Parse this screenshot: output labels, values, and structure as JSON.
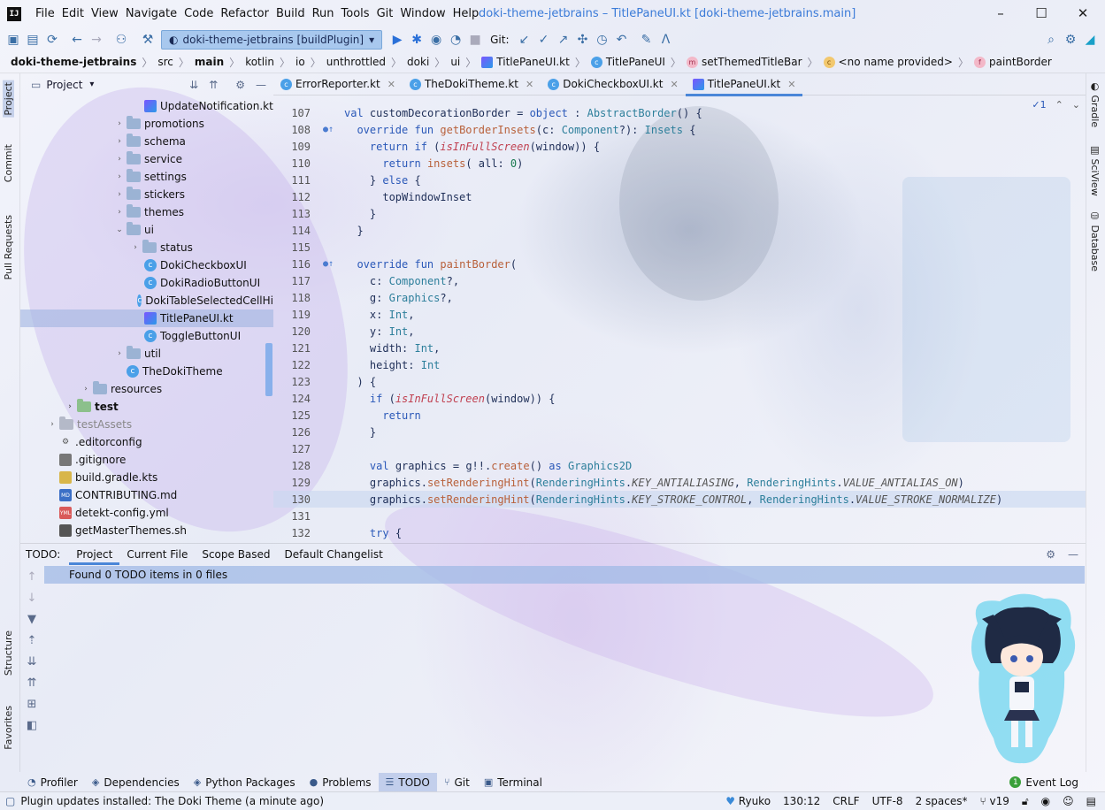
{
  "app": {
    "logo_text": "IJ",
    "window_title": "doki-theme-jetbrains – TitlePaneUI.kt [doki-theme-jetbrains.main]",
    "menu": [
      "File",
      "Edit",
      "View",
      "Navigate",
      "Code",
      "Refactor",
      "Build",
      "Run",
      "Tools",
      "Git",
      "Window",
      "Help"
    ],
    "controls": {
      "minimize": "–",
      "maximize": "☐",
      "close": "✕"
    }
  },
  "toolbar": {
    "run_config": "doki-theme-jetbrains [buildPlugin]",
    "git_label": "Git:"
  },
  "breadcrumb": [
    {
      "text": "doki-theme-jetbrains",
      "bold": true,
      "icon": ""
    },
    {
      "text": "src",
      "bold": false,
      "icon": ""
    },
    {
      "text": "main",
      "bold": true,
      "icon": ""
    },
    {
      "text": "kotlin",
      "bold": false,
      "icon": ""
    },
    {
      "text": "io",
      "bold": false,
      "icon": ""
    },
    {
      "text": "unthrottled",
      "bold": false,
      "icon": ""
    },
    {
      "text": "doki",
      "bold": false,
      "icon": ""
    },
    {
      "text": "ui",
      "bold": false,
      "icon": ""
    },
    {
      "text": "TitlePaneUI.kt",
      "bold": false,
      "icon": "kotlin-file"
    },
    {
      "text": "TitlePaneUI",
      "bold": false,
      "icon": "class"
    },
    {
      "text": "setThemedTitleBar",
      "bold": false,
      "icon": "method"
    },
    {
      "text": "<no name provided>",
      "bold": false,
      "icon": "anonymous"
    },
    {
      "text": "paintBorder",
      "bold": false,
      "icon": "function"
    }
  ],
  "left_strip": [
    "Project",
    "Commit",
    "Pull Requests",
    "Structure",
    "Favorites"
  ],
  "right_strip": [
    "Gradle",
    "SciView",
    "Database"
  ],
  "project_panel": {
    "title": "Project",
    "tree": [
      {
        "label": "UpdateNotification.kt",
        "type": "kt",
        "indent": 6,
        "arrow": ""
      },
      {
        "label": "promotions",
        "type": "folder",
        "indent": 5,
        "arrow": "›"
      },
      {
        "label": "schema",
        "type": "folder",
        "indent": 5,
        "arrow": "›"
      },
      {
        "label": "service",
        "type": "folder",
        "indent": 5,
        "arrow": "›"
      },
      {
        "label": "settings",
        "type": "folder",
        "indent": 5,
        "arrow": "›"
      },
      {
        "label": "stickers",
        "type": "folder",
        "indent": 5,
        "arrow": "›"
      },
      {
        "label": "themes",
        "type": "folder",
        "indent": 5,
        "arrow": "›"
      },
      {
        "label": "ui",
        "type": "folder",
        "indent": 5,
        "arrow": "⌄"
      },
      {
        "label": "status",
        "type": "folder",
        "indent": 6,
        "arrow": "›"
      },
      {
        "label": "DokiCheckboxUI",
        "type": "class",
        "indent": 7,
        "arrow": ""
      },
      {
        "label": "DokiRadioButtonUI",
        "type": "class",
        "indent": 7,
        "arrow": ""
      },
      {
        "label": "DokiTableSelectedCellHi",
        "type": "class",
        "indent": 7,
        "arrow": ""
      },
      {
        "label": "TitlePaneUI.kt",
        "type": "kt",
        "indent": 7,
        "arrow": "",
        "selected": true
      },
      {
        "label": "ToggleButtonUI",
        "type": "class",
        "indent": 7,
        "arrow": ""
      },
      {
        "label": "util",
        "type": "folder",
        "indent": 5,
        "arrow": "›"
      },
      {
        "label": "TheDokiTheme",
        "type": "class",
        "indent": 6,
        "arrow": ""
      },
      {
        "label": "resources",
        "type": "folder",
        "indent": 3,
        "arrow": "›"
      },
      {
        "label": "test",
        "type": "folder-test",
        "indent": 2,
        "arrow": "›",
        "bold": true
      },
      {
        "label": "testAssets",
        "type": "folder-assets",
        "indent": 1,
        "arrow": "›",
        "muted": true
      },
      {
        "label": ".editorconfig",
        "type": "cfg",
        "indent": 1,
        "arrow": ""
      },
      {
        "label": ".gitignore",
        "type": "git",
        "indent": 1,
        "arrow": ""
      },
      {
        "label": "build.gradle.kts",
        "type": "gradle",
        "indent": 1,
        "arrow": ""
      },
      {
        "label": "CONTRIBUTING.md",
        "type": "md",
        "indent": 1,
        "arrow": ""
      },
      {
        "label": "detekt-config.yml",
        "type": "yml",
        "indent": 1,
        "arrow": ""
      },
      {
        "label": "getMasterThemes.sh",
        "type": "sh",
        "indent": 1,
        "arrow": ""
      }
    ]
  },
  "editor_tabs": [
    {
      "label": "ErrorReporter.kt",
      "active": false,
      "icon": "class"
    },
    {
      "label": "TheDokiTheme.kt",
      "active": false,
      "icon": "class"
    },
    {
      "label": "DokiCheckboxUI.kt",
      "active": false,
      "icon": "class"
    },
    {
      "label": "TitlePaneUI.kt",
      "active": true,
      "icon": "kotlin-file"
    }
  ],
  "editor": {
    "inspection_count": "1",
    "cursor_line": 130,
    "lines": [
      {
        "n": "107",
        "code": "val customDecorationBorder = object : AbstractBorder() {",
        "gut": ""
      },
      {
        "n": "108",
        "code": "  override fun getBorderInsets(c: Component?): Insets {",
        "gut": "override"
      },
      {
        "n": "109",
        "code": "    return if (isInFullScreen(window)) {",
        "gut": ""
      },
      {
        "n": "110",
        "code": "      return insets( all: 0)",
        "gut": ""
      },
      {
        "n": "111",
        "code": "    } else {",
        "gut": ""
      },
      {
        "n": "112",
        "code": "      topWindowInset",
        "gut": ""
      },
      {
        "n": "113",
        "code": "    }",
        "gut": ""
      },
      {
        "n": "114",
        "code": "  }",
        "gut": ""
      },
      {
        "n": "115",
        "code": "",
        "gut": ""
      },
      {
        "n": "116",
        "code": "  override fun paintBorder(",
        "gut": "override"
      },
      {
        "n": "117",
        "code": "    c: Component?,",
        "gut": ""
      },
      {
        "n": "118",
        "code": "    g: Graphics?,",
        "gut": ""
      },
      {
        "n": "119",
        "code": "    x: Int,",
        "gut": ""
      },
      {
        "n": "120",
        "code": "    y: Int,",
        "gut": ""
      },
      {
        "n": "121",
        "code": "    width: Int,",
        "gut": ""
      },
      {
        "n": "122",
        "code": "    height: Int",
        "gut": ""
      },
      {
        "n": "123",
        "code": "  ) {",
        "gut": ""
      },
      {
        "n": "124",
        "code": "    if (isInFullScreen(window)) {",
        "gut": ""
      },
      {
        "n": "125",
        "code": "      return",
        "gut": ""
      },
      {
        "n": "126",
        "code": "    }",
        "gut": ""
      },
      {
        "n": "127",
        "code": "",
        "gut": ""
      },
      {
        "n": "128",
        "code": "    val graphics = g!!.create() as Graphics2D",
        "gut": ""
      },
      {
        "n": "129",
        "code": "    graphics.setRenderingHint(RenderingHints.KEY_ANTIALIASING, RenderingHints.VALUE_ANTIALIAS_ON)",
        "gut": ""
      },
      {
        "n": "130",
        "code": "    graphics.setRenderingHint(RenderingHints.KEY_STROKE_CONTROL, RenderingHints.VALUE_STROKE_NORMALIZE)",
        "gut": ""
      },
      {
        "n": "131",
        "code": "",
        "gut": ""
      },
      {
        "n": "132",
        "code": "    try {",
        "gut": ""
      }
    ]
  },
  "todo": {
    "label": "TODO:",
    "tabs": [
      "Project",
      "Current File",
      "Scope Based",
      "Default Changelist"
    ],
    "active_tab": "Project",
    "result": "Found 0 TODO items in 0 files"
  },
  "bottom_tabs": [
    {
      "label": "Profiler",
      "icon": "profiler-icon",
      "glyph": "◔"
    },
    {
      "label": "Dependencies",
      "icon": "dependencies-icon",
      "glyph": "◈"
    },
    {
      "label": "Python Packages",
      "icon": "packages-icon",
      "glyph": "◈"
    },
    {
      "label": "Problems",
      "icon": "problems-icon",
      "glyph": "●"
    },
    {
      "label": "TODO",
      "icon": "todo-icon",
      "glyph": "☰",
      "active": true
    },
    {
      "label": "Git",
      "icon": "git-icon",
      "glyph": "⑂"
    },
    {
      "label": "Terminal",
      "icon": "terminal-icon",
      "glyph": "▣"
    }
  ],
  "event_log": {
    "label": "Event Log",
    "badge": "1"
  },
  "status": {
    "message": "Plugin updates installed: The Doki Theme (a minute ago)",
    "theme_name": "Ryuko",
    "position": "130:12",
    "line_sep": "CRLF",
    "encoding": "UTF-8",
    "indent": "2 spaces*",
    "version": "v19"
  },
  "colors": {
    "accent": "#4a86d8",
    "selection": "#a0b4e1",
    "keyword": "#2a58b8",
    "function": "#b8603a"
  }
}
